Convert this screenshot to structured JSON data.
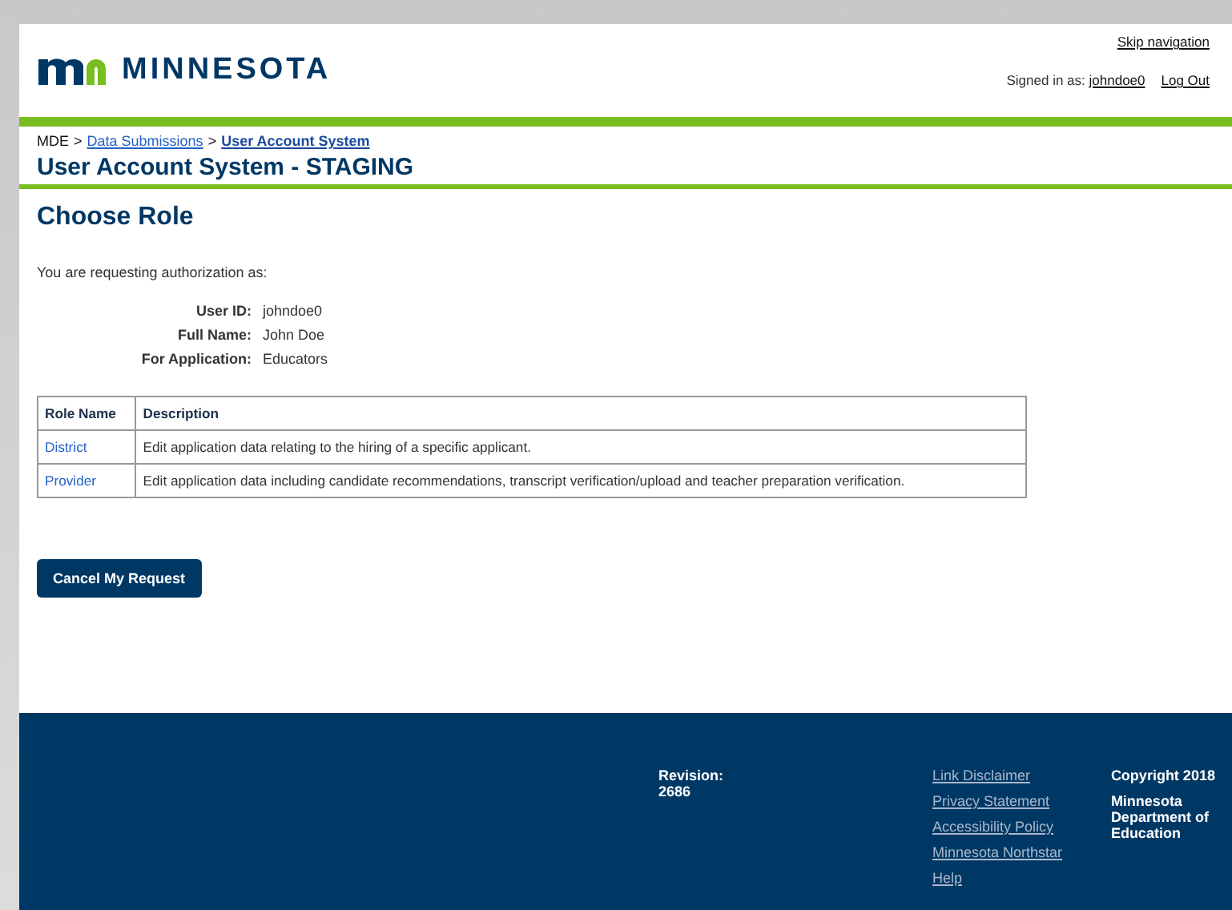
{
  "header": {
    "logo_text": "MINNESOTA",
    "skip_link": "Skip navigation",
    "signed_in_label": "Signed in as:",
    "username": "johndoe0",
    "logout": "Log Out"
  },
  "breadcrumb": {
    "root": "MDE",
    "separator": ">",
    "links": [
      {
        "label": "Data Submissions",
        "current": false
      },
      {
        "label": "User Account System",
        "current": true
      }
    ]
  },
  "app_title": "User Account System - STAGING",
  "page_title": "Choose Role",
  "intro": "You are requesting authorization as:",
  "details": [
    {
      "label": "User ID:",
      "value": "johndoe0"
    },
    {
      "label": "Full Name:",
      "value": "John Doe"
    },
    {
      "label": "For Application:",
      "value": "Educators"
    }
  ],
  "table": {
    "columns": [
      "Role Name",
      "Description"
    ],
    "rows": [
      {
        "role": "District",
        "description": "Edit application data relating to the hiring of a specific applicant."
      },
      {
        "role": "Provider",
        "description": "Edit application data including candidate recommendations, transcript verification/upload and teacher preparation verification."
      }
    ]
  },
  "cancel_button": "Cancel My Request",
  "footer": {
    "revision": "Revision: 2686",
    "links": [
      "Link Disclaimer",
      "Privacy Statement",
      "Accessibility Policy",
      "Minnesota Northstar",
      "Help"
    ],
    "copyright": "Copyright 2018",
    "organization": "Minnesota Department of Education"
  }
}
